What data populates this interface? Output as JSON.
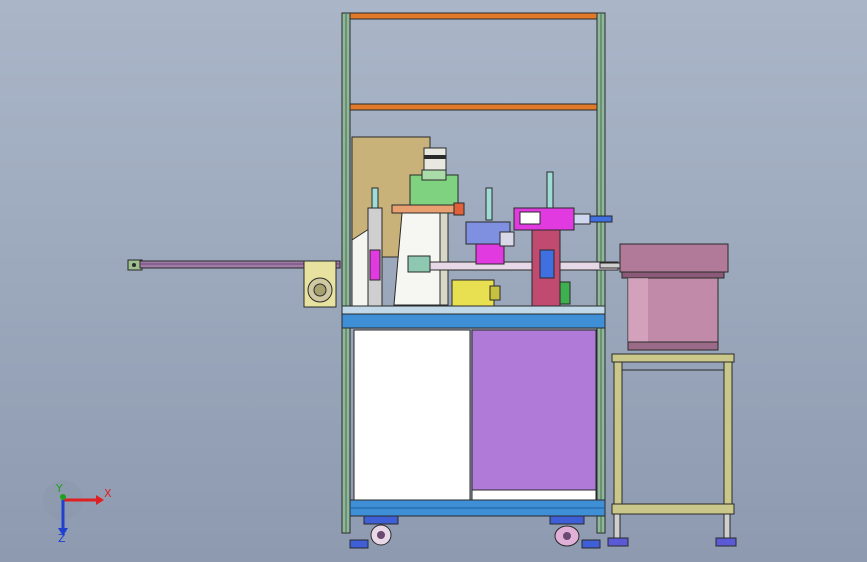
{
  "viewport": {
    "background_top": "#aab6c8",
    "background_bottom": "#8e9ab0"
  },
  "axis_triad": {
    "x_label": "X",
    "y_label": "Y",
    "z_label": "Z",
    "x_color": "#e02020",
    "y_color": "#20a020",
    "z_color": "#2040d0"
  },
  "colors": {
    "frame_green": "#8fb89a",
    "frame_blue": "#3f8fd6",
    "orange_bar": "#e07a2a",
    "white_panel": "#ffffff",
    "purple_panel": "#b07ad8",
    "bowl_mauve": "#b07a98",
    "stand_khaki": "#c9c88a",
    "plate_tan": "#c8b27a",
    "yellow_motor": "#e8e050",
    "magenta_part": "#e03ae0"
  },
  "icons": {
    "axis_triad": "axis-triad-icon",
    "caster_wheel": "caster-wheel-icon",
    "vibratory_bowl": "vibratory-bowl-icon"
  }
}
